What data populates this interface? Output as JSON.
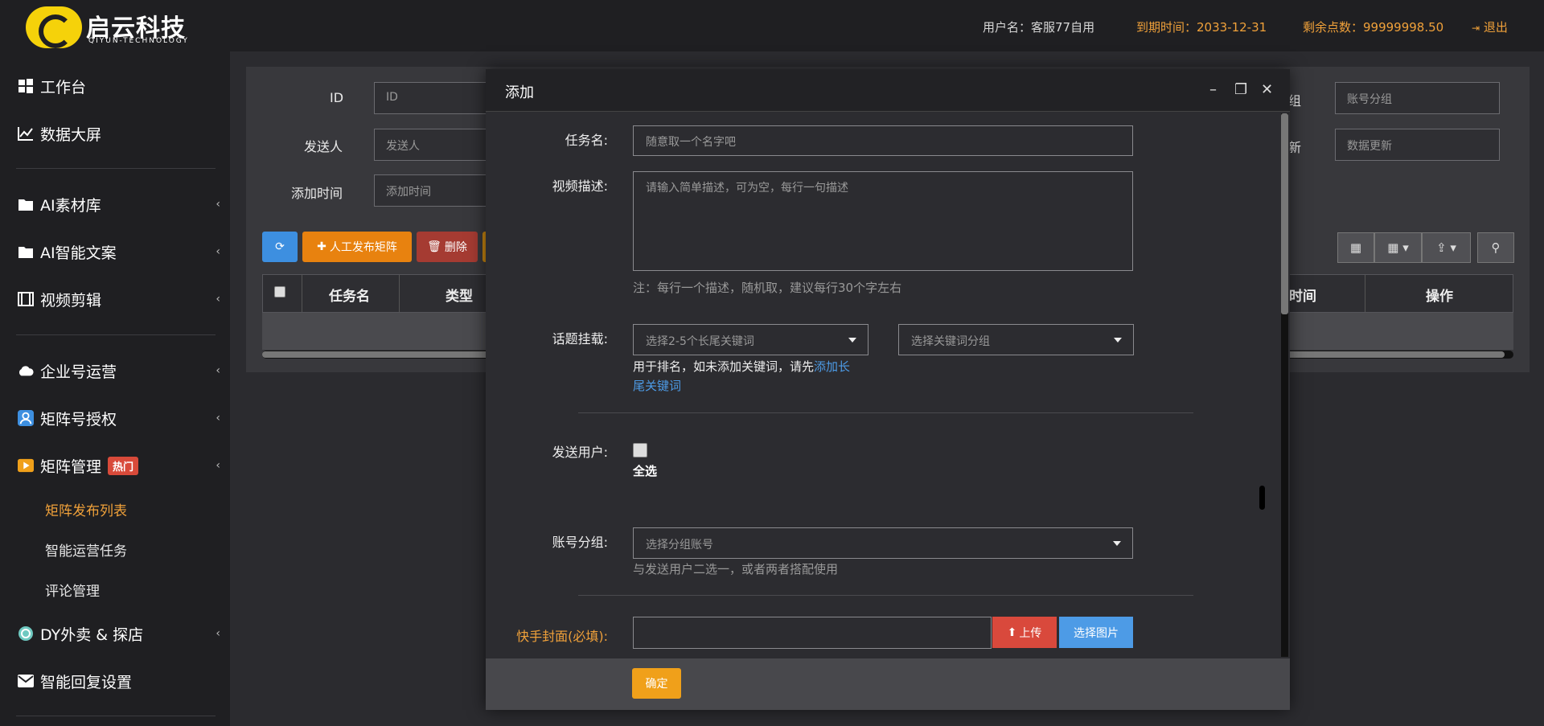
{
  "header": {
    "logo_text": "启云科技",
    "logo_sub": "QIYUN-TECHNOLOGY",
    "username": "用户名：客服77自用",
    "expire": "到期时间：2033-12-31",
    "points": "剩余点数：99999998.50",
    "logout": "退出"
  },
  "sidebar": {
    "items": [
      {
        "label": "工作台",
        "icon": "windows-icon"
      },
      {
        "label": "数据大屏",
        "icon": "line-chart-icon"
      },
      {
        "label": "AI素材库",
        "icon": "folder-icon"
      },
      {
        "label": "AI智能文案",
        "icon": "folder-icon"
      },
      {
        "label": "视频剪辑",
        "icon": "film-icon"
      },
      {
        "label": "企业号运营",
        "icon": "cloud-icon"
      },
      {
        "label": "矩阵号授权",
        "icon": "user-icon"
      },
      {
        "label": "矩阵管理",
        "icon": "play-icon",
        "badge": "热门"
      },
      {
        "label": "DY外卖 & 探店",
        "icon": "globe-icon"
      },
      {
        "label": "智能回复设置",
        "icon": "envelope-icon"
      }
    ],
    "sub_items": [
      {
        "label": "矩阵发布列表",
        "active": true
      },
      {
        "label": "智能运营任务"
      },
      {
        "label": "评论管理"
      }
    ]
  },
  "filters": {
    "id_label": "ID",
    "id_placeholder": "ID",
    "sender_label": "发送人",
    "sender_placeholder": "发送人",
    "time_label": "添加时间",
    "time_placeholder": "添加时间",
    "group_label_partial": "组",
    "group_placeholder": "账号分组",
    "update_label_partial": "新",
    "update_placeholder": "数据更新"
  },
  "toolbar": {
    "manual_publish": "人工发布矩阵",
    "delete": "删除"
  },
  "table": {
    "headers": [
      "任务名",
      "类型",
      "时间",
      "操作"
    ]
  },
  "modal": {
    "title": "添加",
    "task_name_label": "任务名:",
    "task_name_placeholder": "随意取一个名字吧",
    "video_desc_label": "视频描述:",
    "video_desc_placeholder": "请输入简单描述，可为空，每行一句描述",
    "video_desc_hint": "注：每行一个描述，随机取，建议每行30个字左右",
    "topic_label": "话题挂载:",
    "topic_select1": "选择2-5个长尾关键词",
    "topic_select2": "选择关键词分组",
    "topic_hint_prefix": "用于排名，如未添加关键词，请先",
    "topic_hint_link1": "添加长",
    "topic_hint_link2": "尾关键词",
    "send_user_label": "发送用户:",
    "select_all": "全选",
    "account_group_label": "账号分组:",
    "account_group_placeholder": "选择分组账号",
    "account_group_hint": "与发送用户二选一，或者两者搭配使用",
    "cover_label": "快手封面(必填):",
    "upload_btn": "上传",
    "choose_img_btn": "选择图片",
    "confirm_btn": "确定"
  },
  "colors": {
    "accent": "#f0a13a",
    "blue": "#3d8fe0",
    "orange_btn": "#e8820f",
    "red_btn": "#a53b32",
    "upload_red": "#d9493c",
    "link": "#4d9be6"
  }
}
